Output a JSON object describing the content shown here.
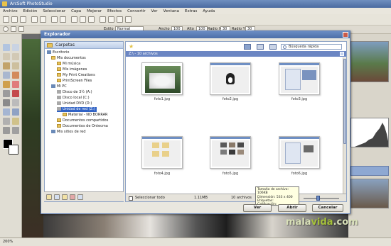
{
  "app": {
    "title": "ArcSoft PhotoStudio",
    "menu": [
      "Archivo",
      "Edición",
      "Seleccionar",
      "Capa",
      "Mejorar",
      "Efectos",
      "Convertir",
      "Ver",
      "Ventana",
      "Extras",
      "Ayuda"
    ],
    "toolbar2": {
      "fields": [
        "Estilo",
        "Normal",
        "Ancho",
        "100",
        "Alto",
        "100",
        "Radio X",
        "30",
        "Radio Y",
        "30"
      ]
    },
    "status": "200%"
  },
  "dialog": {
    "title": "Explorador",
    "folders_header": "Carpetas",
    "tree": [
      {
        "label": "Escritorio",
        "icon": "desktop-icon"
      },
      {
        "label": "Mis documentos",
        "icon": "folder-icon"
      },
      {
        "label": "Mi música",
        "icon": "folder-icon"
      },
      {
        "label": "Mis imágenes",
        "icon": "folder-icon"
      },
      {
        "label": "My Print Creations",
        "icon": "folder-icon"
      },
      {
        "label": "PrintScreen Files",
        "icon": "folder-icon"
      },
      {
        "label": "Mi PC",
        "icon": "computer-icon"
      },
      {
        "label": "Disco de 3½ (A:)",
        "icon": "drive-icon"
      },
      {
        "label": "Disco local (C:)",
        "icon": "drive-icon"
      },
      {
        "label": "Unidad DVD (D:)",
        "icon": "drive-icon"
      },
      {
        "label": "Unidad de red (Z:)",
        "icon": "drive-icon",
        "selected": true
      },
      {
        "label": "Material - NO BORRAR",
        "icon": "folder-icon"
      },
      {
        "label": "Documentos compartidos",
        "icon": "folder-icon"
      },
      {
        "label": "Documentos de Ontecma",
        "icon": "folder-icon"
      },
      {
        "label": "Mis sitios de red",
        "icon": "network-icon"
      }
    ],
    "search_placeholder": "Búsqueda rápida",
    "path": "Z:\\ - 10 archivos",
    "thumbnails": [
      {
        "caption": "foto1.jpg"
      },
      {
        "caption": "foto2.jpg"
      },
      {
        "caption": "foto3.jpg"
      },
      {
        "caption": "foto4.jpg"
      },
      {
        "caption": "foto5.jpg"
      },
      {
        "caption": "foto6.jpg"
      }
    ],
    "tooltip": {
      "line1": "Tamaño de archivo: 106KB",
      "line2": "Dimensión: 533 x 400",
      "line3": "Etiquetas:",
      "line4": "Calificación:"
    },
    "select_all": "Seleccionar todo",
    "total_size": "1.11MB",
    "file_count": "10 archivos",
    "buttons": {
      "ver": "Ver",
      "abrir": "Abrir",
      "cancelar": "Cancelar"
    }
  },
  "watermark": {
    "part1": "mala",
    "part2": "vida",
    "part3": ".com"
  }
}
